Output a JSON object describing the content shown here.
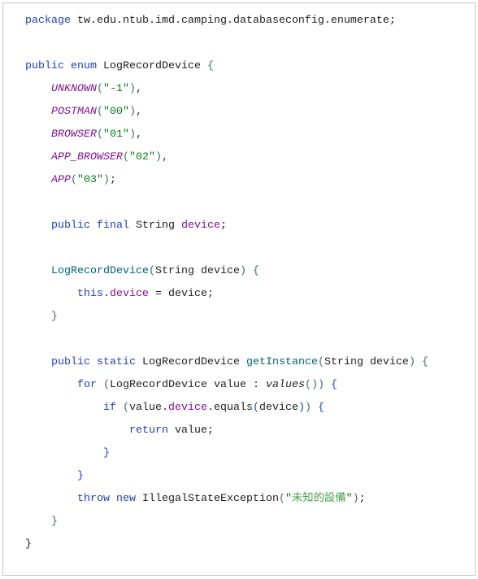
{
  "code_lines": [
    [
      [
        "kw",
        "package"
      ],
      [
        "t",
        " tw.edu.ntub.imd.camping.databaseconfig.enumerate;"
      ]
    ],
    [],
    [
      [
        "kw",
        "public enum"
      ],
      [
        "t",
        " LogRecordDevice "
      ],
      [
        "p",
        "{"
      ]
    ],
    [
      [
        "t",
        "    "
      ],
      [
        "const",
        "UNKNOWN"
      ],
      [
        "p",
        "("
      ],
      [
        "str",
        "\"-1\""
      ],
      [
        "p",
        ")"
      ],
      [
        "t",
        ","
      ]
    ],
    [
      [
        "t",
        "    "
      ],
      [
        "const",
        "POSTMAN"
      ],
      [
        "p",
        "("
      ],
      [
        "str",
        "\"00\""
      ],
      [
        "p",
        ")"
      ],
      [
        "t",
        ","
      ]
    ],
    [
      [
        "t",
        "    "
      ],
      [
        "const",
        "BROWSER"
      ],
      [
        "p",
        "("
      ],
      [
        "str",
        "\"01\""
      ],
      [
        "p",
        ")"
      ],
      [
        "t",
        ","
      ]
    ],
    [
      [
        "t",
        "    "
      ],
      [
        "const",
        "APP_BROWSER"
      ],
      [
        "p",
        "("
      ],
      [
        "str",
        "\"02\""
      ],
      [
        "p",
        ")"
      ],
      [
        "t",
        ","
      ]
    ],
    [
      [
        "t",
        "    "
      ],
      [
        "const",
        "APP"
      ],
      [
        "p",
        "("
      ],
      [
        "str",
        "\"03\""
      ],
      [
        "p",
        ")"
      ],
      [
        "t",
        ";"
      ]
    ],
    [],
    [
      [
        "t",
        "    "
      ],
      [
        "kw",
        "public final"
      ],
      [
        "t",
        " String "
      ],
      [
        "fld",
        "device"
      ],
      [
        "t",
        ";"
      ]
    ],
    [],
    [
      [
        "t",
        "    "
      ],
      [
        "fn",
        "LogRecordDevice"
      ],
      [
        "p",
        "("
      ],
      [
        "t",
        "String device"
      ],
      [
        "p",
        ")"
      ],
      [
        "t",
        " "
      ],
      [
        "p",
        "{"
      ]
    ],
    [
      [
        "t",
        "        "
      ],
      [
        "kw",
        "this"
      ],
      [
        "t",
        "."
      ],
      [
        "fld",
        "device"
      ],
      [
        "t",
        " = device;"
      ]
    ],
    [
      [
        "t",
        "    "
      ],
      [
        "p",
        "}"
      ]
    ],
    [],
    [
      [
        "t",
        "    "
      ],
      [
        "kw",
        "public static"
      ],
      [
        "t",
        " LogRecordDevice "
      ],
      [
        "fn",
        "getInstance"
      ],
      [
        "p",
        "("
      ],
      [
        "t",
        "String device"
      ],
      [
        "p",
        ")"
      ],
      [
        "t",
        " "
      ],
      [
        "p",
        "{"
      ]
    ],
    [
      [
        "t",
        "        "
      ],
      [
        "kw",
        "for"
      ],
      [
        "t",
        " "
      ],
      [
        "p",
        "("
      ],
      [
        "t",
        "LogRecordDevice value : "
      ],
      [
        "it",
        "values"
      ],
      [
        "p",
        "()"
      ],
      [
        "p",
        ")"
      ],
      [
        "t",
        " "
      ],
      [
        "br",
        "{"
      ]
    ],
    [
      [
        "t",
        "            "
      ],
      [
        "kw",
        "if"
      ],
      [
        "t",
        " "
      ],
      [
        "p",
        "("
      ],
      [
        "t",
        "value."
      ],
      [
        "fld",
        "device"
      ],
      [
        "t",
        ".equals"
      ],
      [
        "br",
        "("
      ],
      [
        "t",
        "device"
      ],
      [
        "br",
        ")"
      ],
      [
        "p",
        ")"
      ],
      [
        "t",
        " "
      ],
      [
        "br",
        "{"
      ]
    ],
    [
      [
        "t",
        "                "
      ],
      [
        "kw",
        "return"
      ],
      [
        "t",
        " value;"
      ]
    ],
    [
      [
        "t",
        "            "
      ],
      [
        "br",
        "}"
      ]
    ],
    [
      [
        "t",
        "        "
      ],
      [
        "br",
        "}"
      ]
    ],
    [
      [
        "t",
        "        "
      ],
      [
        "kw",
        "throw new"
      ],
      [
        "t",
        " IllegalStateException"
      ],
      [
        "p",
        "("
      ],
      [
        "str",
        "\""
      ],
      [
        "cjk",
        "未知的設備"
      ],
      [
        "str",
        "\""
      ],
      [
        "p",
        ")"
      ],
      [
        "t",
        ";"
      ]
    ],
    [
      [
        "t",
        "    "
      ],
      [
        "p",
        "}"
      ]
    ],
    [
      [
        "t",
        "}"
      ]
    ]
  ]
}
